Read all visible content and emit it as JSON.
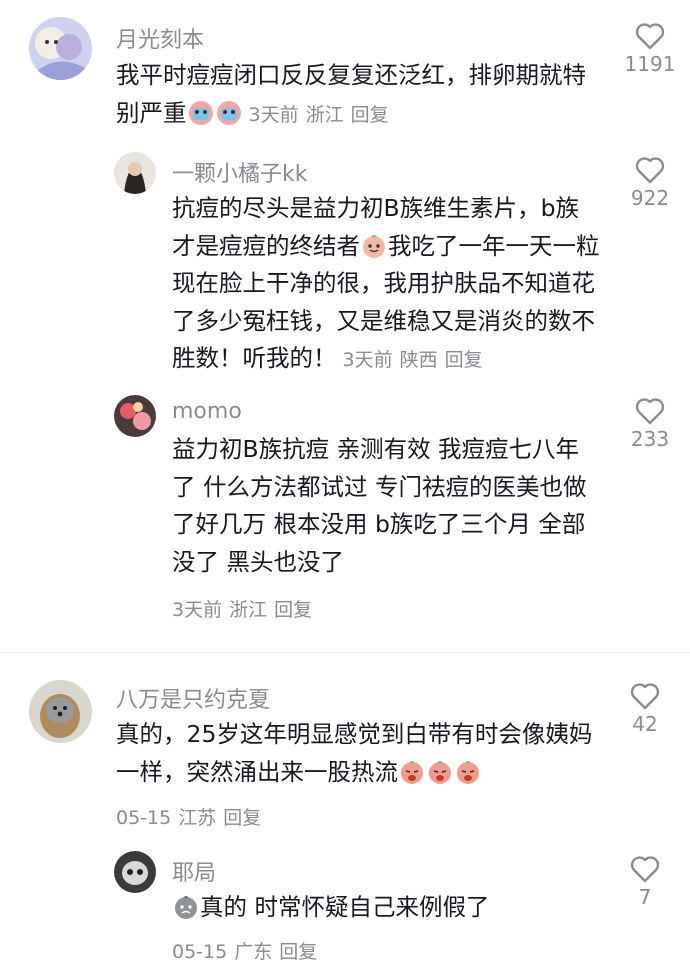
{
  "comments": [
    {
      "username": "月光刻本",
      "text": "我平时痘痘闭口反反复复还泛红，排卵期就特别严重",
      "time": "3天前",
      "location": "浙江",
      "reply": "回复",
      "likes": "1191"
    },
    {
      "username": "一颗小橘子kk",
      "text": "抗痘的尽头是益力初B族维生素片，b族才是痘痘的终结者",
      "text2": "我吃了一年一天一粒现在脸上干净的很，我用护肤品不知道花了多少冤枉钱，又是维稳又是消炎的数不胜数！听我的！",
      "time": "3天前",
      "location": "陕西",
      "reply": "回复",
      "likes": "922"
    },
    {
      "username": "momo",
      "text": "益力初B族抗痘 亲测有效 我痘痘七八年了 什么方法都试过 专门祛痘的医美也做了好几万 根本没用 b族吃了三个月 全部没了 黑头也没了",
      "time": "3天前",
      "location": "浙江",
      "reply": "回复",
      "likes": "233"
    },
    {
      "username": "八万是只约克夏",
      "text": "真的，25岁这年明显感觉到白带有时会像姨妈一样，突然涌出来一股热流",
      "time": "05-15",
      "location": "江苏",
      "reply": "回复",
      "likes": "42"
    },
    {
      "username": "耶局",
      "text": "真的 时常怀疑自己来例假了",
      "time": "05-15",
      "location": "广东",
      "reply": "回复",
      "likes": "7"
    }
  ],
  "colors": {
    "text": "#161823",
    "meta": "#8a8b91",
    "heart": "#8a8b91"
  }
}
